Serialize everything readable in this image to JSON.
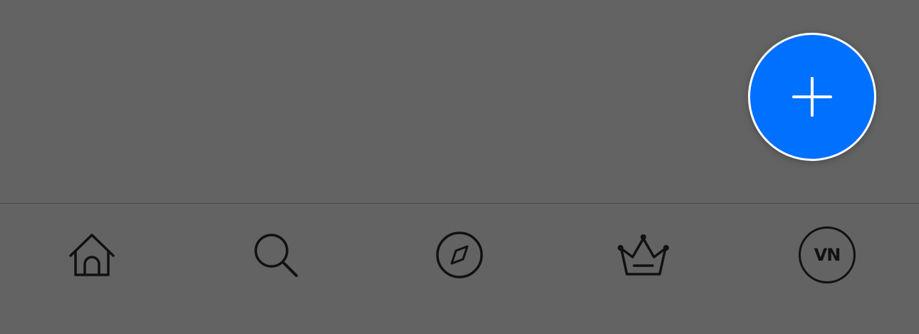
{
  "colors": {
    "background": "#636363",
    "fab_fill": "#0070ff",
    "fab_border": "#ffffff",
    "icon_stroke": "#111111"
  },
  "fab": {
    "icon": "plus-icon"
  },
  "tab_bar": {
    "items": [
      {
        "id": "home",
        "icon": "home-icon"
      },
      {
        "id": "search",
        "icon": "search-icon"
      },
      {
        "id": "explore",
        "icon": "compass-icon"
      },
      {
        "id": "premium",
        "icon": "crown-icon"
      },
      {
        "id": "profile",
        "icon": "avatar",
        "avatar_text": "VN"
      }
    ]
  }
}
